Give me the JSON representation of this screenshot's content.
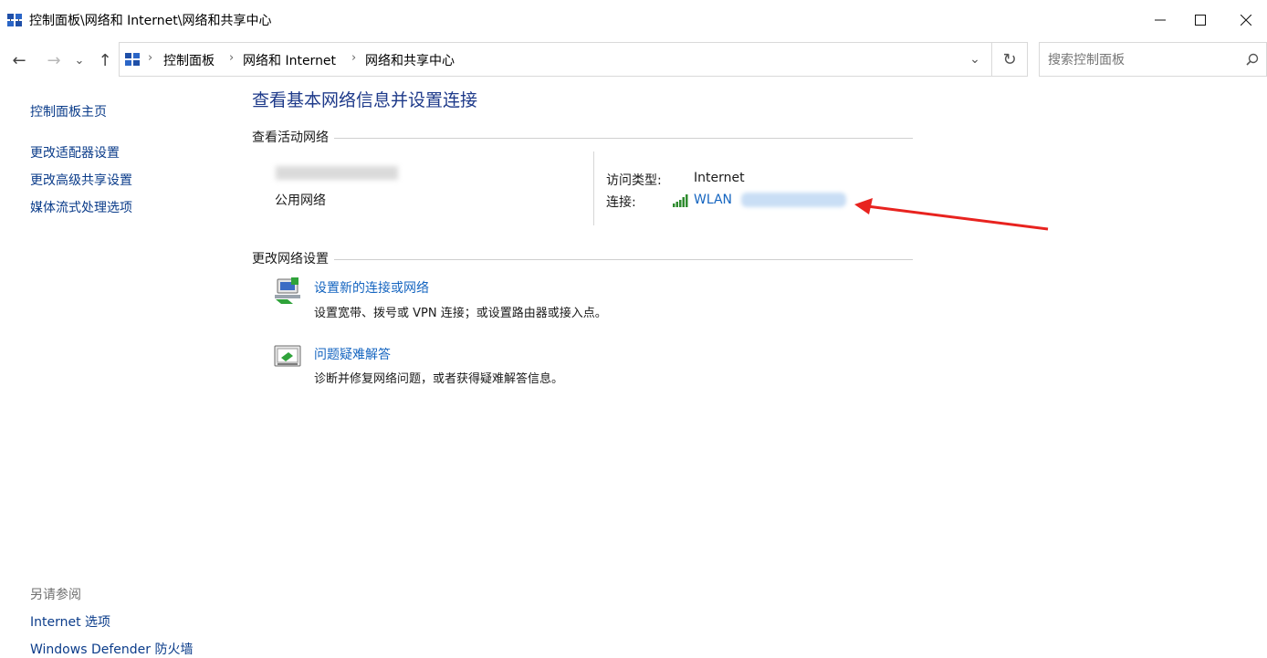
{
  "window": {
    "title": "控制面板\\网络和 Internet\\网络和共享中心",
    "icon": "network-icon",
    "buttons": {
      "minimize": "minimize-icon",
      "maximize": "maximize-icon",
      "close": "close-icon"
    }
  },
  "nav": {
    "back": "←",
    "forward": "→",
    "recent": "⌄",
    "up": "↑",
    "refresh": "↻",
    "dropdown": "⌄"
  },
  "breadcrumb": {
    "items": [
      "控制面板",
      "网络和 Internet",
      "网络和共享中心"
    ],
    "separator": "›"
  },
  "search": {
    "placeholder": "搜索控制面板",
    "icon": "search-icon"
  },
  "sidebar": {
    "home": "控制面板主页",
    "links": [
      "更改适配器设置",
      "更改高级共享设置",
      "媒体流式处理选项"
    ],
    "see_also_title": "另请参阅",
    "see_also": [
      "Internet 选项",
      "Windows Defender 防火墙"
    ]
  },
  "main": {
    "title": "查看基本网络信息并设置连接",
    "active_networks": {
      "heading": "查看活动网络",
      "network_type": "公用网络",
      "access_type_label": "访问类型:",
      "access_type_value": "Internet",
      "connection_label": "连接:",
      "connection_value": "WLAN",
      "signal_icon": "wifi-signal-icon"
    },
    "change_settings": {
      "heading": "更改网络设置",
      "items": [
        {
          "title": "设置新的连接或网络",
          "desc": "设置宽带、拨号或 VPN 连接；或设置路由器或接入点。",
          "icon": "new-connection-icon"
        },
        {
          "title": "问题疑难解答",
          "desc": "诊断并修复网络问题，或者获得疑难解答信息。",
          "icon": "troubleshoot-icon"
        }
      ]
    }
  },
  "colors": {
    "link": "#1565c0",
    "title": "#1e3a8a",
    "arrow": "#e8231f"
  }
}
